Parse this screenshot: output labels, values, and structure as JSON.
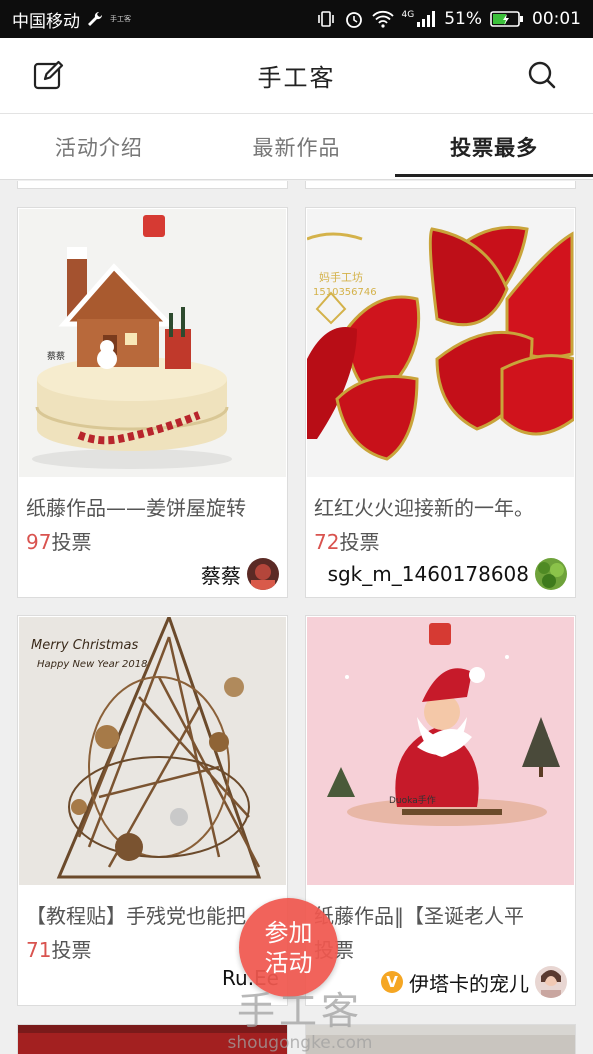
{
  "status_bar": {
    "carrier": "中国移动",
    "small_text": "手工客",
    "network": "4G",
    "battery": "51%",
    "time": "00:01"
  },
  "header": {
    "title": "手工客",
    "left_icon": "edit-icon",
    "right_icon": "search-icon"
  },
  "tabs": [
    {
      "label": "活动介绍",
      "active": false
    },
    {
      "label": "最新作品",
      "active": false
    },
    {
      "label": "投票最多",
      "active": true
    }
  ],
  "cards": [
    {
      "title": "纸藤作品——姜饼屋旋转",
      "votes": "97",
      "votes_suffix": "投票",
      "author": "蔡蔡",
      "image": "gingerbread-house-music-box",
      "image_text": "蔡蔡"
    },
    {
      "title": "红红火火迎接新的一年。",
      "votes": "72",
      "votes_suffix": "投票",
      "author": "sgk_m_1460178608",
      "image": "red-woven-petals",
      "image_text": "妈手工坊",
      "image_text2": "1510356746"
    },
    {
      "title": "【教程贴】手残党也能把",
      "votes": "71",
      "votes_suffix": "投票",
      "author": "Ru.Ee",
      "image": "rattan-christmas-tree",
      "image_text": "Merry Christmas",
      "image_text2": "Happy New Year 2018"
    },
    {
      "title": "纸藤作品‖【圣诞老人平",
      "votes": "",
      "votes_suffix": "投票",
      "author": "伊塔卡的宠儿",
      "badge": "V",
      "image": "santa-claus-figure",
      "image_text": "Duoka手作"
    }
  ],
  "fab": {
    "line1": "参加",
    "line2": "活动"
  },
  "watermark": {
    "cn": "手工客",
    "en": "shougongke.com"
  },
  "colors": {
    "accent": "#f0584f",
    "vote": "#d9534f",
    "tab_indicator": "#222222"
  }
}
